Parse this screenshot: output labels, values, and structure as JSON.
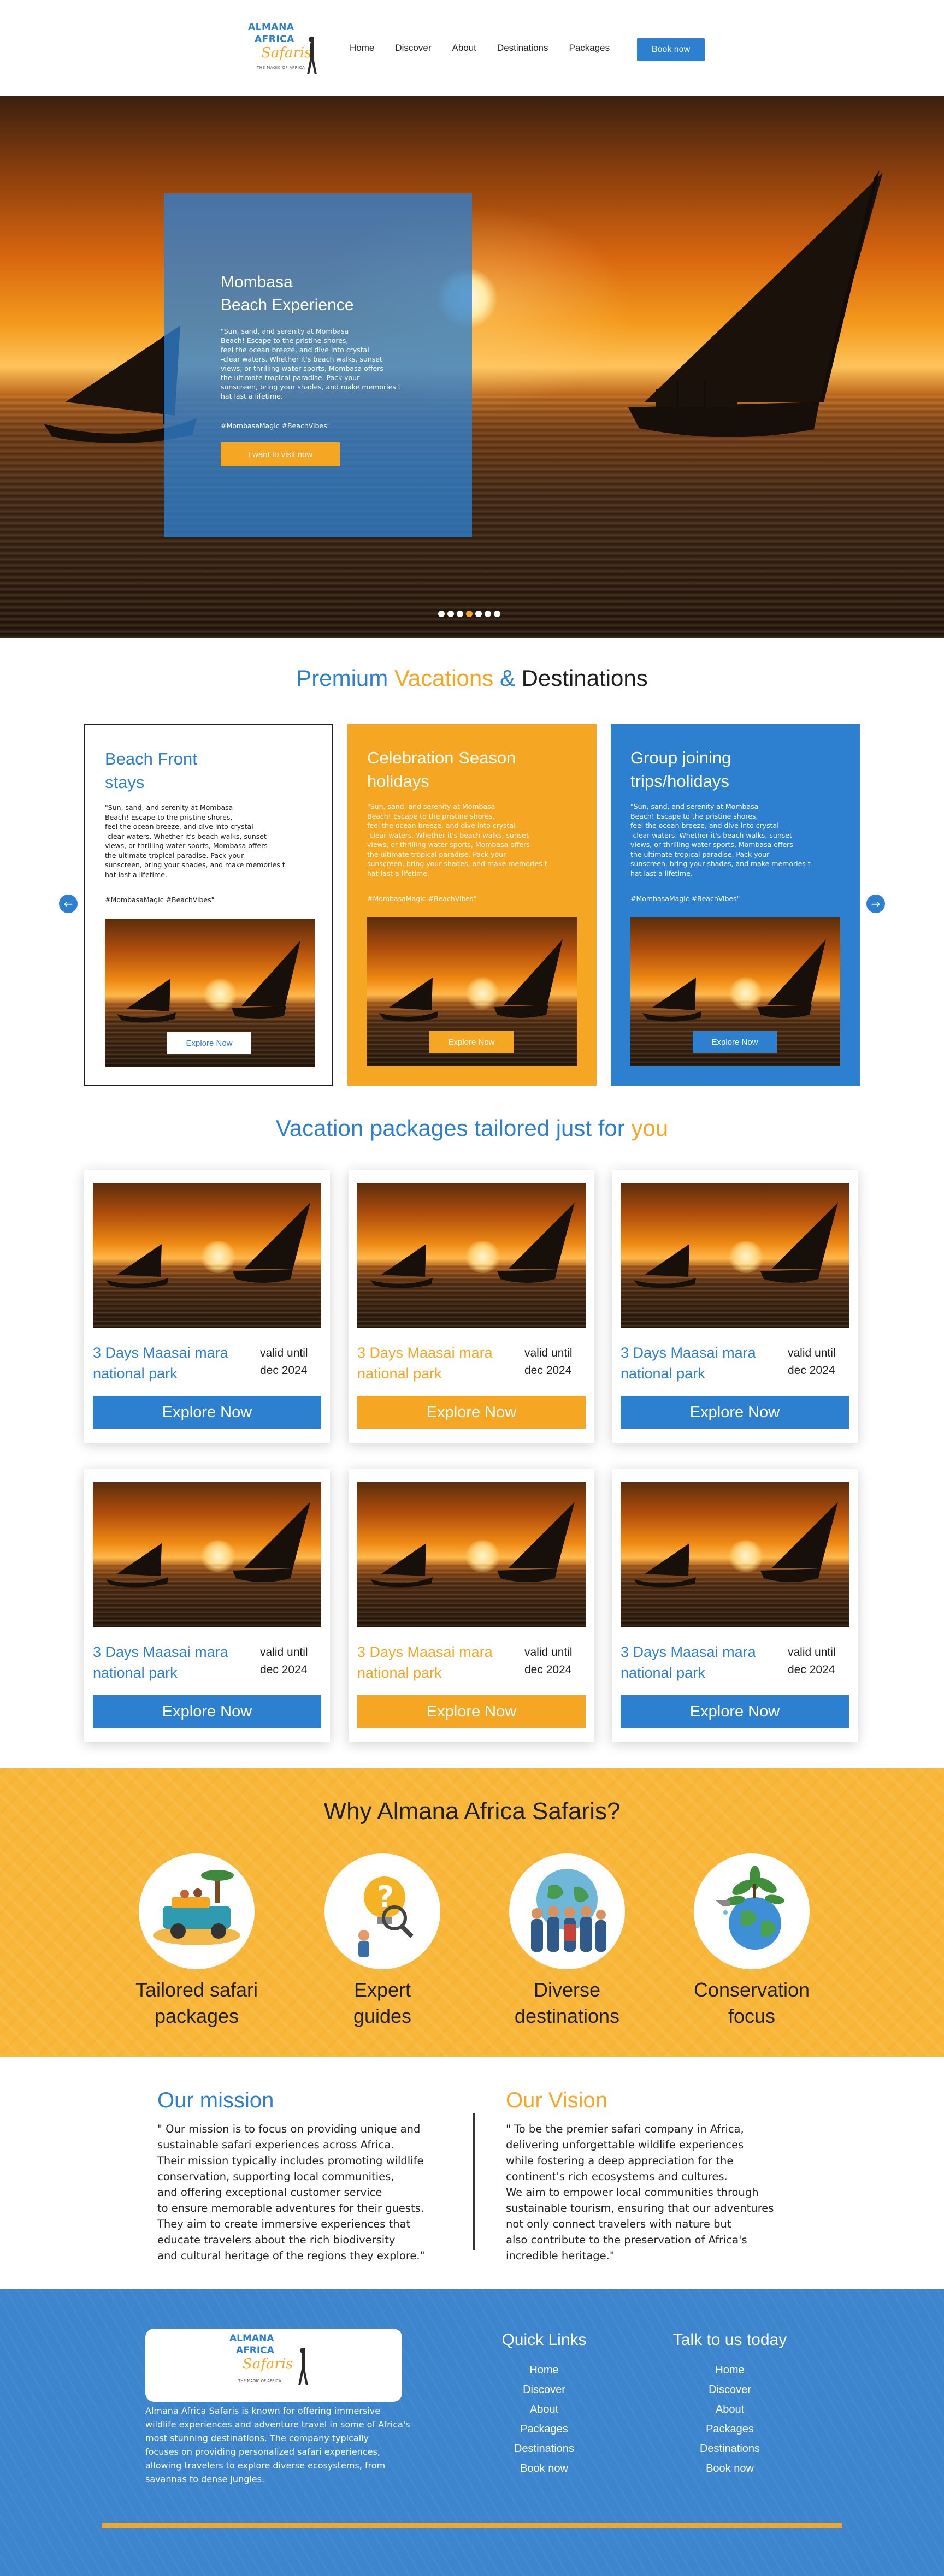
{
  "header": {
    "logo": {
      "line1": "ALMANA",
      "line2": "AFRICA",
      "line3": "Safaris",
      "tagline": "THE MAGIC OF AFRICA"
    },
    "nav": [
      "Home",
      "Discover",
      "About",
      "Destinations",
      "Packages"
    ],
    "book_label": "Book now"
  },
  "hero": {
    "title": "Mombasa\nBeach Experience",
    "title_line1": "Mombasa",
    "title_line2": "Beach Experience",
    "body": "\"Sun, sand, and serenity at Mombasa\nBeach! Escape to the pristine shores,\nfeel the ocean breeze, and dive into crystal\n-clear waters. Whether it's beach walks, sunset\nviews, or thrilling water sports, Mombasa offers\nthe ultimate tropical paradise. Pack your\nsunscreen, bring your shades, and make memories t\nhat last a lifetime.",
    "tags": "#MombasaMagic #BeachVibes\"",
    "cta": "I want to visit now",
    "slides": 7,
    "active_slide": 3
  },
  "premium": {
    "title_part1": "Premium ",
    "title_part2": "Vacations",
    "title_part3": " & ",
    "title_part4": "Destinations",
    "cards": [
      {
        "title": "Beach Front\nstays",
        "title_line1": "Beach Front",
        "title_line2": "stays",
        "body": "\"Sun, sand, and serenity at Mombasa\nBeach! Escape to the pristine shores,\nfeel the ocean breeze, and dive into crystal\n-clear waters. Whether it's beach walks, sunset\nviews, or thrilling water sports, Mombasa offers\nthe ultimate tropical paradise. Pack your\nsunscreen, bring your shades, and make memories t\nhat last a lifetime.",
        "tags": "#MombasaMagic #BeachVibes\"",
        "button": "Explore Now"
      },
      {
        "title": "Celebration Season\nholidays",
        "title_line1": "Celebration Season",
        "title_line2": "holidays",
        "body": "\"Sun, sand, and serenity at Mombasa\nBeach! Escape to the pristine shores,\nfeel the ocean breeze, and dive into crystal\n-clear waters. Whether it's beach walks, sunset\nviews, or thrilling water sports, Mombasa offers\nthe ultimate tropical paradise. Pack your\nsunscreen, bring your shades, and make memories t\nhat last a lifetime.",
        "tags": "#MombasaMagic #BeachVibes\"",
        "button": "Explore Now"
      },
      {
        "title": "Group joining\ntrips/holidays",
        "title_line1": "Group joining",
        "title_line2": "trips/holidays",
        "body": "\"Sun, sand, and serenity at Mombasa\nBeach! Escape to the pristine shores,\nfeel the ocean breeze, and dive into crystal\n-clear waters. Whether it's beach walks, sunset\nviews, or thrilling water sports, Mombasa offers\nthe ultimate tropical paradise. Pack your\nsunscreen, bring your shades, and make memories t\nhat last a lifetime.",
        "tags": "#MombasaMagic #BeachVibes\"",
        "button": "Explore Now"
      }
    ]
  },
  "packages": {
    "title_part1": "Vacation packages tailored just for ",
    "title_part2": "you",
    "items": [
      {
        "name_line1": "3 Days Maasai mara",
        "name_line2": "national park",
        "valid_line1": "valid until",
        "valid_line2": "dec 2024",
        "button": "Explore Now",
        "color": "#2d7fd0"
      },
      {
        "name_line1": "3 Days Maasai mara",
        "name_line2": "national park",
        "valid_line1": "valid until",
        "valid_line2": "dec 2024",
        "button": "Explore Now",
        "color": "#f5a623"
      },
      {
        "name_line1": "3 Days Maasai mara",
        "name_line2": "national park",
        "valid_line1": "valid until",
        "valid_line2": "dec 2024",
        "button": "Explore Now",
        "color": "#2d7fd0"
      },
      {
        "name_line1": "3 Days Maasai mara",
        "name_line2": "national park",
        "valid_line1": "valid until",
        "valid_line2": "dec 2024",
        "button": "Explore Now",
        "color": "#2d7fd0"
      },
      {
        "name_line1": "3 Days Maasai mara",
        "name_line2": "national park",
        "valid_line1": "valid until",
        "valid_line2": "dec 2024",
        "button": "Explore Now",
        "color": "#f5a623"
      },
      {
        "name_line1": "3 Days Maasai mara",
        "name_line2": "national park",
        "valid_line1": "valid until",
        "valid_line2": "dec 2024",
        "button": "Explore Now",
        "color": "#2d7fd0"
      }
    ]
  },
  "why": {
    "title": "Why Almana Africa Safaris?",
    "features": [
      {
        "line1": "Tailored safari",
        "line2": "packages",
        "icon": "safari-jeep-icon"
      },
      {
        "line1": "Expert",
        "line2": "guides",
        "icon": "lightbulb-question-icon"
      },
      {
        "line1": "Diverse",
        "line2": "destinations",
        "icon": "people-globe-icon"
      },
      {
        "line1": "Conservation",
        "line2": "focus",
        "icon": "earth-plant-icon"
      }
    ]
  },
  "mission": {
    "mission_title": "Our mission",
    "mission_text": "\" Our mission is to focus on providing unique and\nsustainable safari experiences across Africa.\nTheir mission typically includes promoting wildlife\nconservation, supporting local communities,\nand offering exceptional customer service\n to ensure memorable adventures for their guests.\nThey aim to create immersive experiences that\neducate travelers about the rich biodiversity\n and cultural heritage of the regions they explore.\"",
    "vision_title": "Our Vision",
    "vision_text": "\" To be the premier safari company in Africa,\ndelivering unforgettable wildlife experiences\nwhile fostering a deep appreciation for the\ncontinent's rich ecosystems and cultures.\nWe aim to empower local communities through\nsustainable tourism, ensuring that our adventures\n not only connect travelers with nature but\nalso contribute to the preservation of Africa's\nincredible heritage.\""
  },
  "footer": {
    "about": "Almana Africa Safaris is known for offering immersive\nwildlife experiences and adventure travel in some of Africa's\nmost stunning destinations. The company typically\nfocuses on providing personalized safari experiences,\nallowing travelers to explore diverse ecosystems, from\nsavannas to dense jungles.",
    "quick_links_title": "Quick Links",
    "quick_links": [
      "Home",
      "Discover",
      "About",
      "Packages",
      "Destinations",
      "Book now"
    ],
    "talk_title": "Talk to us today",
    "talk_links": [
      "Home",
      "Discover",
      "About",
      "Packages",
      "Destinations",
      "Book now"
    ]
  },
  "colors": {
    "blue": "#2d7fd0",
    "orange": "#f5a623",
    "footer_blue": "#3d86ce"
  }
}
